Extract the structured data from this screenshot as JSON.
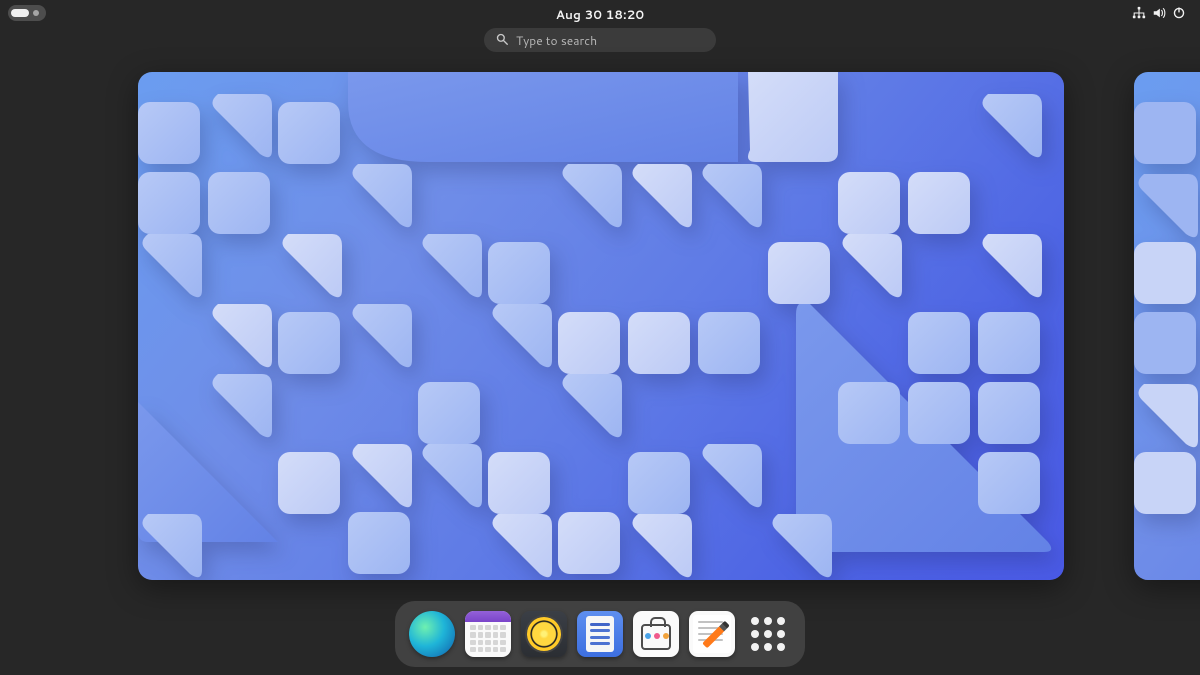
{
  "topbar": {
    "clock": "Aug 30  18:20"
  },
  "search": {
    "placeholder": "Type to search"
  },
  "dock": {
    "items": [
      {
        "name": "Web"
      },
      {
        "name": "Calendar"
      },
      {
        "name": "Music"
      },
      {
        "name": "To Do"
      },
      {
        "name": "Software"
      },
      {
        "name": "Text Editor"
      },
      {
        "name": "Show Apps"
      }
    ]
  }
}
